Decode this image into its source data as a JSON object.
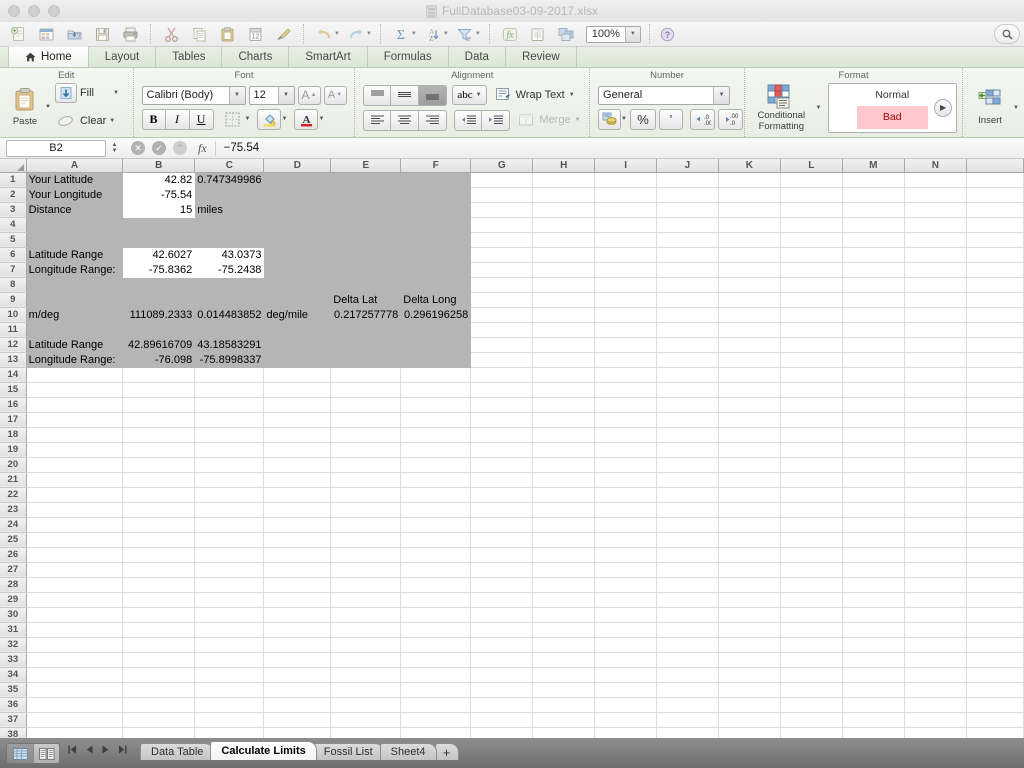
{
  "window": {
    "title": "FullDatabase03-09-2017.xlsx"
  },
  "toolbar": {
    "icons": [
      "new-document-icon",
      "new-from-template-icon",
      "open-icon",
      "save-icon",
      "print-icon",
      "cut-icon",
      "copy-icon",
      "paste-icon",
      "clipboard-history-icon",
      "format-painter-icon",
      "undo-icon",
      "redo-icon",
      "autosum-icon",
      "sort-icon",
      "filter-icon",
      "formula-builder-icon",
      "sheet-view-icon",
      "media-browser-icon",
      "help-icon"
    ],
    "zoom_value": "100%",
    "search_icon": "search-icon"
  },
  "tabs": {
    "items": [
      {
        "label": "Home",
        "active": true,
        "icon": "home-icon"
      },
      {
        "label": "Layout",
        "active": false
      },
      {
        "label": "Tables",
        "active": false
      },
      {
        "label": "Charts",
        "active": false
      },
      {
        "label": "SmartArt",
        "active": false
      },
      {
        "label": "Formulas",
        "active": false
      },
      {
        "label": "Data",
        "active": false
      },
      {
        "label": "Review",
        "active": false
      }
    ]
  },
  "ribbon": {
    "edit": {
      "title": "Edit",
      "paste_label": "Paste",
      "fill_label": "Fill",
      "clear_label": "Clear"
    },
    "font": {
      "title": "Font",
      "font_name": "Calibri (Body)",
      "font_size": "12",
      "grow_label": "A",
      "shrink_label": "A",
      "bold_label": "B",
      "italic_label": "I",
      "underline_label": "U"
    },
    "alignment": {
      "title": "Alignment",
      "orientation_label": "abc",
      "wrap_label": "Wrap Text",
      "merge_label": "Merge"
    },
    "number": {
      "title": "Number",
      "format_value": "General",
      "percent_label": "%",
      "comma_label": "’"
    },
    "format": {
      "title": "Format",
      "conditional_label_line1": "Conditional",
      "conditional_label_line2": "Formatting",
      "style_normal": "Normal",
      "style_bad": "Bad",
      "bad_text_color": "#9c0006",
      "bad_bg_color": "#ffc7ce"
    },
    "cells": {
      "insert_label": "Insert"
    }
  },
  "formula_bar": {
    "name_box": "B2",
    "value": "−75.54",
    "cancel_icon": "cancel-icon",
    "accept_icon": "accept-icon",
    "formula_icon": "fx-icon"
  },
  "grid": {
    "columns": [
      "A",
      "B",
      "C",
      "D",
      "E",
      "F",
      "G",
      "H",
      "I",
      "J",
      "K",
      "L",
      "M",
      "N"
    ],
    "rows": [
      {
        "n": "1",
        "cells": {
          "A": "Your Latitude",
          "B": "42.82",
          "C": "0.747349986"
        }
      },
      {
        "n": "2",
        "cells": {
          "A": "Your Longitude",
          "B": "-75.54",
          "C": ""
        }
      },
      {
        "n": "3",
        "cells": {
          "A": "Distance",
          "B": "15",
          "C": "miles"
        }
      },
      {
        "n": "4",
        "cells": {}
      },
      {
        "n": "5",
        "cells": {}
      },
      {
        "n": "6",
        "cells": {
          "A": "Latitude Range",
          "B": "42.6027",
          "C": "43.0373"
        }
      },
      {
        "n": "7",
        "cells": {
          "A": "Longitude Range:",
          "B": "-75.8362",
          "C": "-75.2438"
        }
      },
      {
        "n": "8",
        "cells": {}
      },
      {
        "n": "9",
        "cells": {
          "E": "Delta Lat",
          "F": "Delta Long"
        }
      },
      {
        "n": "10",
        "cells": {
          "A": "m/deg",
          "B": "111089.2333",
          "C": "0.014483852",
          "D": "deg/mile",
          "E": "0.217257778",
          "F": "0.296196258"
        }
      },
      {
        "n": "11",
        "cells": {}
      },
      {
        "n": "12",
        "cells": {
          "A": "Latitude Range",
          "B": "42.89616709",
          "C": "43.18583291"
        }
      },
      {
        "n": "13",
        "cells": {
          "A": "Longitude Range:",
          "B": "-76.098",
          "C": "-75.8998337"
        }
      },
      {
        "n": "14",
        "cells": {}
      },
      {
        "n": "15",
        "cells": {}
      },
      {
        "n": "16",
        "cells": {}
      },
      {
        "n": "17",
        "cells": {}
      },
      {
        "n": "18",
        "cells": {}
      },
      {
        "n": "19",
        "cells": {}
      },
      {
        "n": "20",
        "cells": {}
      },
      {
        "n": "21",
        "cells": {}
      },
      {
        "n": "22",
        "cells": {}
      },
      {
        "n": "23",
        "cells": {}
      },
      {
        "n": "24",
        "cells": {}
      },
      {
        "n": "25",
        "cells": {}
      },
      {
        "n": "26",
        "cells": {}
      },
      {
        "n": "27",
        "cells": {}
      },
      {
        "n": "28",
        "cells": {}
      },
      {
        "n": "29",
        "cells": {}
      },
      {
        "n": "30",
        "cells": {}
      },
      {
        "n": "31",
        "cells": {}
      },
      {
        "n": "32",
        "cells": {}
      },
      {
        "n": "33",
        "cells": {}
      },
      {
        "n": "34",
        "cells": {}
      },
      {
        "n": "35",
        "cells": {}
      },
      {
        "n": "36",
        "cells": {}
      },
      {
        "n": "37",
        "cells": {}
      },
      {
        "n": "38",
        "cells": {}
      }
    ]
  },
  "sheet_bar": {
    "view_normal_icon": "normal-view-icon",
    "view_layout_icon": "page-layout-view-icon",
    "nav_first": "first-sheet-icon",
    "nav_prev": "prev-sheet-icon",
    "nav_next": "next-sheet-icon",
    "nav_last": "last-sheet-icon",
    "sheets": [
      {
        "label": "Data Table",
        "active": false
      },
      {
        "label": "Calculate Limits",
        "active": true
      },
      {
        "label": "Fossil List",
        "active": false
      },
      {
        "label": "Sheet4",
        "active": false
      }
    ],
    "add_label": "+"
  }
}
